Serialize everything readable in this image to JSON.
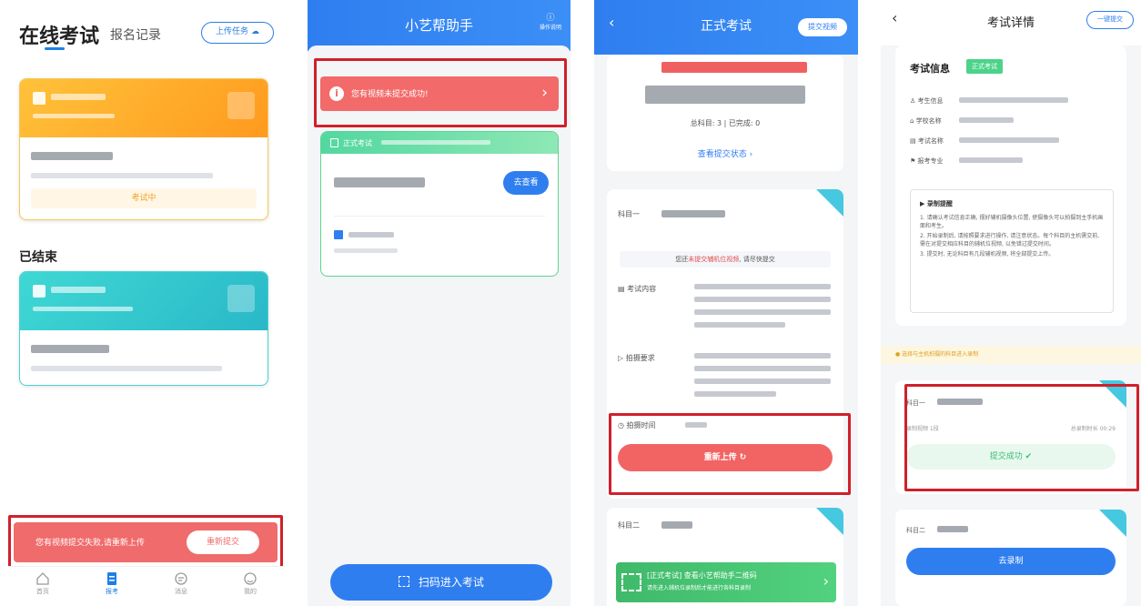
{
  "phone1": {
    "title": "在线考试",
    "tab_records": "报名记录",
    "upload_tasks": "上传任务",
    "exam_status": "考试中",
    "ended_section": "已结束",
    "toast_message": "您有视频提交失败,请重新上传",
    "toast_button": "重新提交",
    "tabbar": [
      "首页",
      "报考",
      "消息",
      "我的"
    ]
  },
  "phone2": {
    "title": "小艺帮助手",
    "help_label": "操作说明",
    "alert_message": "您有视频未提交成功!",
    "card_header": "正式考试",
    "view_button": "去查看",
    "scan_button": "扫码进入考试"
  },
  "phone3": {
    "title": "正式考试",
    "submit_video_button": "提交视频",
    "progress_text": "总科目: 3 | 已完成: 0",
    "view_status_link": "查看提交状态",
    "subject1_label": "科目一",
    "notice_prefix": "您还",
    "notice_highlight": "未提交辅机位视频",
    "notice_suffix": ", 请尽快提交",
    "row_content": "考试内容",
    "row_requirements": "拍摄要求",
    "row_time": "拍摄时间",
    "reupload_button": "重新上传",
    "subject2_label": "科目二",
    "banner_line1": "[正式考试] 查看小艺帮助手二维码",
    "banner_line2": "请先进入辅机位录制后才能进行各科目录制"
  },
  "phone4": {
    "title": "考试详情",
    "submit_all_button": "一键提交",
    "info_title": "考试信息",
    "info_badge": "正式考试",
    "row_candidate": "考生信息",
    "row_school": "学校名称",
    "row_exam": "考试名称",
    "row_major": "报考专业",
    "tips_title": "录制提醒",
    "tips": [
      "1. 请确认考试信息正确, 摆好辅机摄像头位置, 使摄像头可以拍摄到主手机画面和考生。",
      "2. 开始录制后, 请按照要求进行操作, 请注意状态。每个科目的主机需交前, 需在对提交相应科目的辅机位视频, 以免错过提交时间。",
      "3. 提交时, 无论科目有几段辅机视频, 将全部提交上传。"
    ],
    "hint": "选择与主机拍摄的科目进入录制",
    "sub1_label": "科目一",
    "sub1_stat_left": "录制视频 1段",
    "sub1_stat_right": "总录制时长 00:29",
    "success_label": "提交成功",
    "sub2_label": "科目二",
    "record_button": "去录制"
  },
  "colors": {
    "primary_blue": "#2f7ef0",
    "alert_red": "#f06b6b",
    "success_green": "#3bbd73",
    "highlight_box": "#d0202a"
  }
}
